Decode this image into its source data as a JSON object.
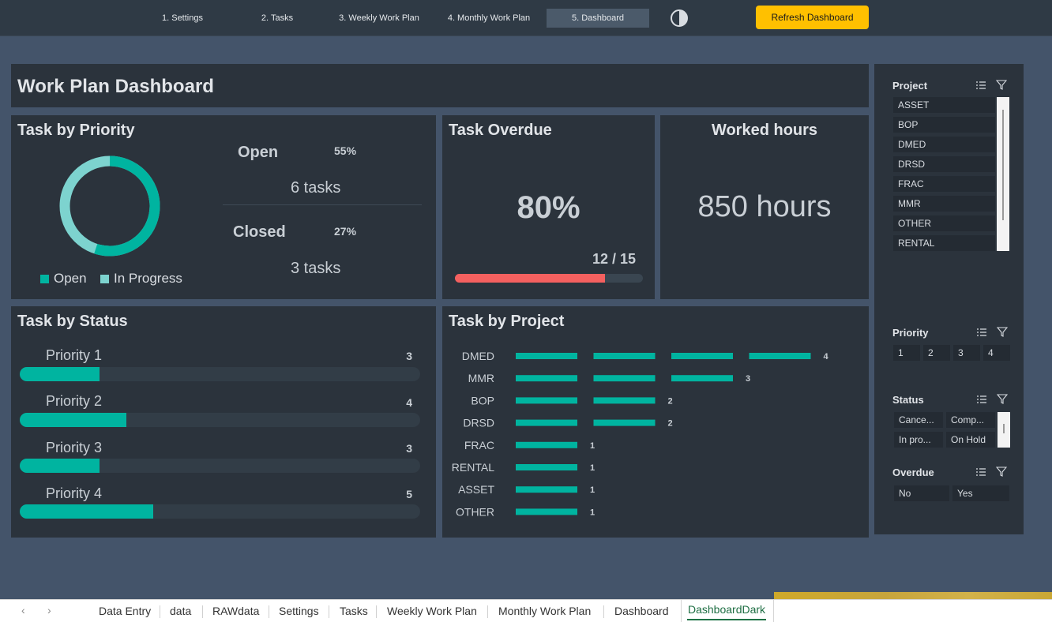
{
  "nav": {
    "items": [
      "1. Settings",
      "2. Tasks",
      "3. Weekly Work Plan",
      "4. Monthly Work Plan",
      "5. Dashboard"
    ],
    "active_index": 4,
    "theme_icon": "contrast-icon",
    "refresh_label": "Refresh Dashboard",
    "refresh_color": "#ffc000"
  },
  "dashboard": {
    "title": "Work Plan Dashboard"
  },
  "priority": {
    "title": "Task by Priority",
    "open_label": "Open",
    "open_pct": "55%",
    "open_tasks": "6 tasks",
    "closed_label": "Closed",
    "closed_pct": "27%",
    "closed_tasks": "3 tasks",
    "legend": [
      {
        "label": "Open",
        "color": "#00b4a0"
      },
      {
        "label": "In Progress",
        "color": "#7dd3cf"
      }
    ],
    "donut_share_open": 0.55
  },
  "overdue": {
    "title": "Task Overdue",
    "percent": "80%",
    "fraction": "12 / 15",
    "fill_ratio": 0.8,
    "bar_color": "#f4605f"
  },
  "hours": {
    "title": "Worked hours",
    "value": "850 hours"
  },
  "status": {
    "title": "Task by Status",
    "max": 15,
    "items": [
      {
        "label": "Priority 1",
        "count": "3",
        "value": 3
      },
      {
        "label": "Priority 2",
        "count": "4",
        "value": 4
      },
      {
        "label": "Priority 3",
        "count": "3",
        "value": 3
      },
      {
        "label": "Priority 4",
        "count": "5",
        "value": 5
      }
    ]
  },
  "chart_data": {
    "type": "bar",
    "title": "Task by Project",
    "categories": [
      "DMED",
      "MMR",
      "BOP",
      "DRSD",
      "FRAC",
      "RENTAL",
      "ASSET",
      "OTHER"
    ],
    "values": [
      4,
      3,
      2,
      2,
      1,
      1,
      1,
      1
    ],
    "orientation": "horizontal",
    "color": "#00b4a0"
  },
  "slicers": {
    "project": {
      "title": "Project",
      "items": [
        "ASSET",
        "BOP",
        "DMED",
        "DRSD",
        "FRAC",
        "MMR",
        "OTHER",
        "RENTAL"
      ]
    },
    "priority": {
      "title": "Priority",
      "items": [
        "1",
        "2",
        "3",
        "4"
      ]
    },
    "status": {
      "title": "Status",
      "items": [
        "Cance...",
        "Comp...",
        "In pro...",
        "On Hold"
      ]
    },
    "overdue": {
      "title": "Overdue",
      "items": [
        "No",
        "Yes"
      ]
    }
  },
  "sheet_tabs": {
    "items": [
      "Data Entry",
      "data",
      "RAWdata",
      "Settings",
      "Tasks",
      "Weekly Work Plan",
      "Monthly Work Plan",
      "Dashboard",
      "DashboardDark"
    ],
    "active": "DashboardDark"
  }
}
